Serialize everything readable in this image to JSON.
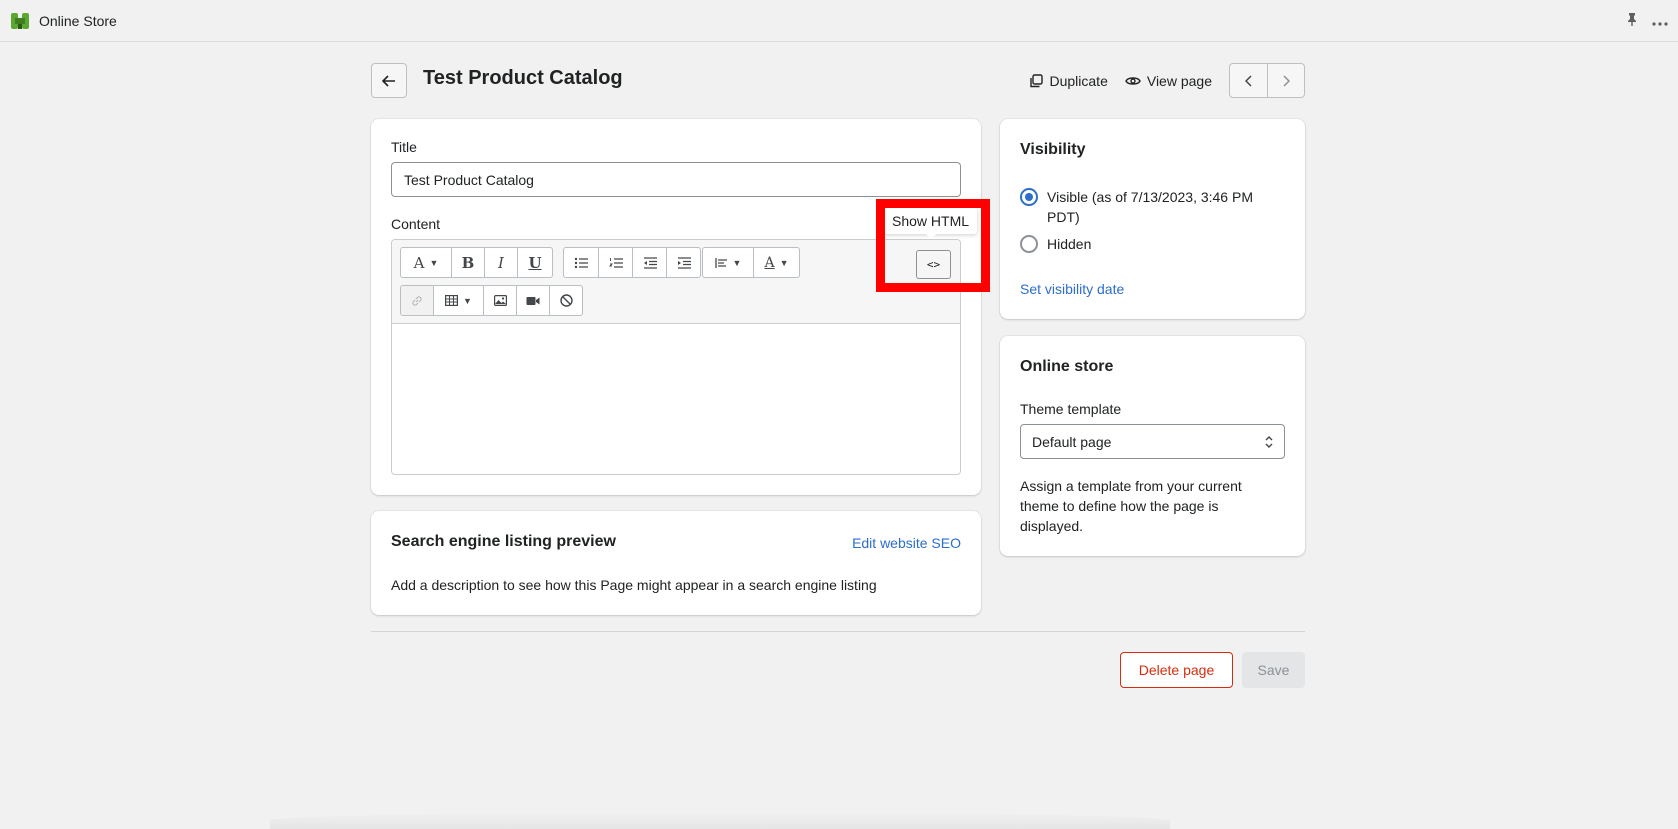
{
  "topbar": {
    "app_title": "Online Store"
  },
  "header": {
    "title": "Test Product Catalog",
    "duplicate_label": "Duplicate",
    "view_page_label": "View page"
  },
  "main": {
    "title_label": "Title",
    "title_value": "Test Product Catalog",
    "content_label": "Content",
    "html_button_label": "<>",
    "tooltip": "Show HTML"
  },
  "seo": {
    "title": "Search engine listing preview",
    "edit_link": "Edit website SEO",
    "description": "Add a description to see how this Page might appear in a search engine listing"
  },
  "visibility": {
    "title": "Visibility",
    "options": [
      {
        "label": "Visible (as of 7/13/2023, 3:46 PM PDT)",
        "checked": true
      },
      {
        "label": "Hidden",
        "checked": false
      }
    ],
    "set_date_link": "Set visibility date"
  },
  "online_store": {
    "title": "Online store",
    "template_label": "Theme template",
    "template_value": "Default page",
    "help": "Assign a template from your current theme to define how the page is displayed."
  },
  "footer": {
    "delete_label": "Delete page",
    "save_label": "Save"
  },
  "colors": {
    "accent": "#2c6ecb",
    "danger": "#d82c0d",
    "highlight": "#ff0000"
  }
}
